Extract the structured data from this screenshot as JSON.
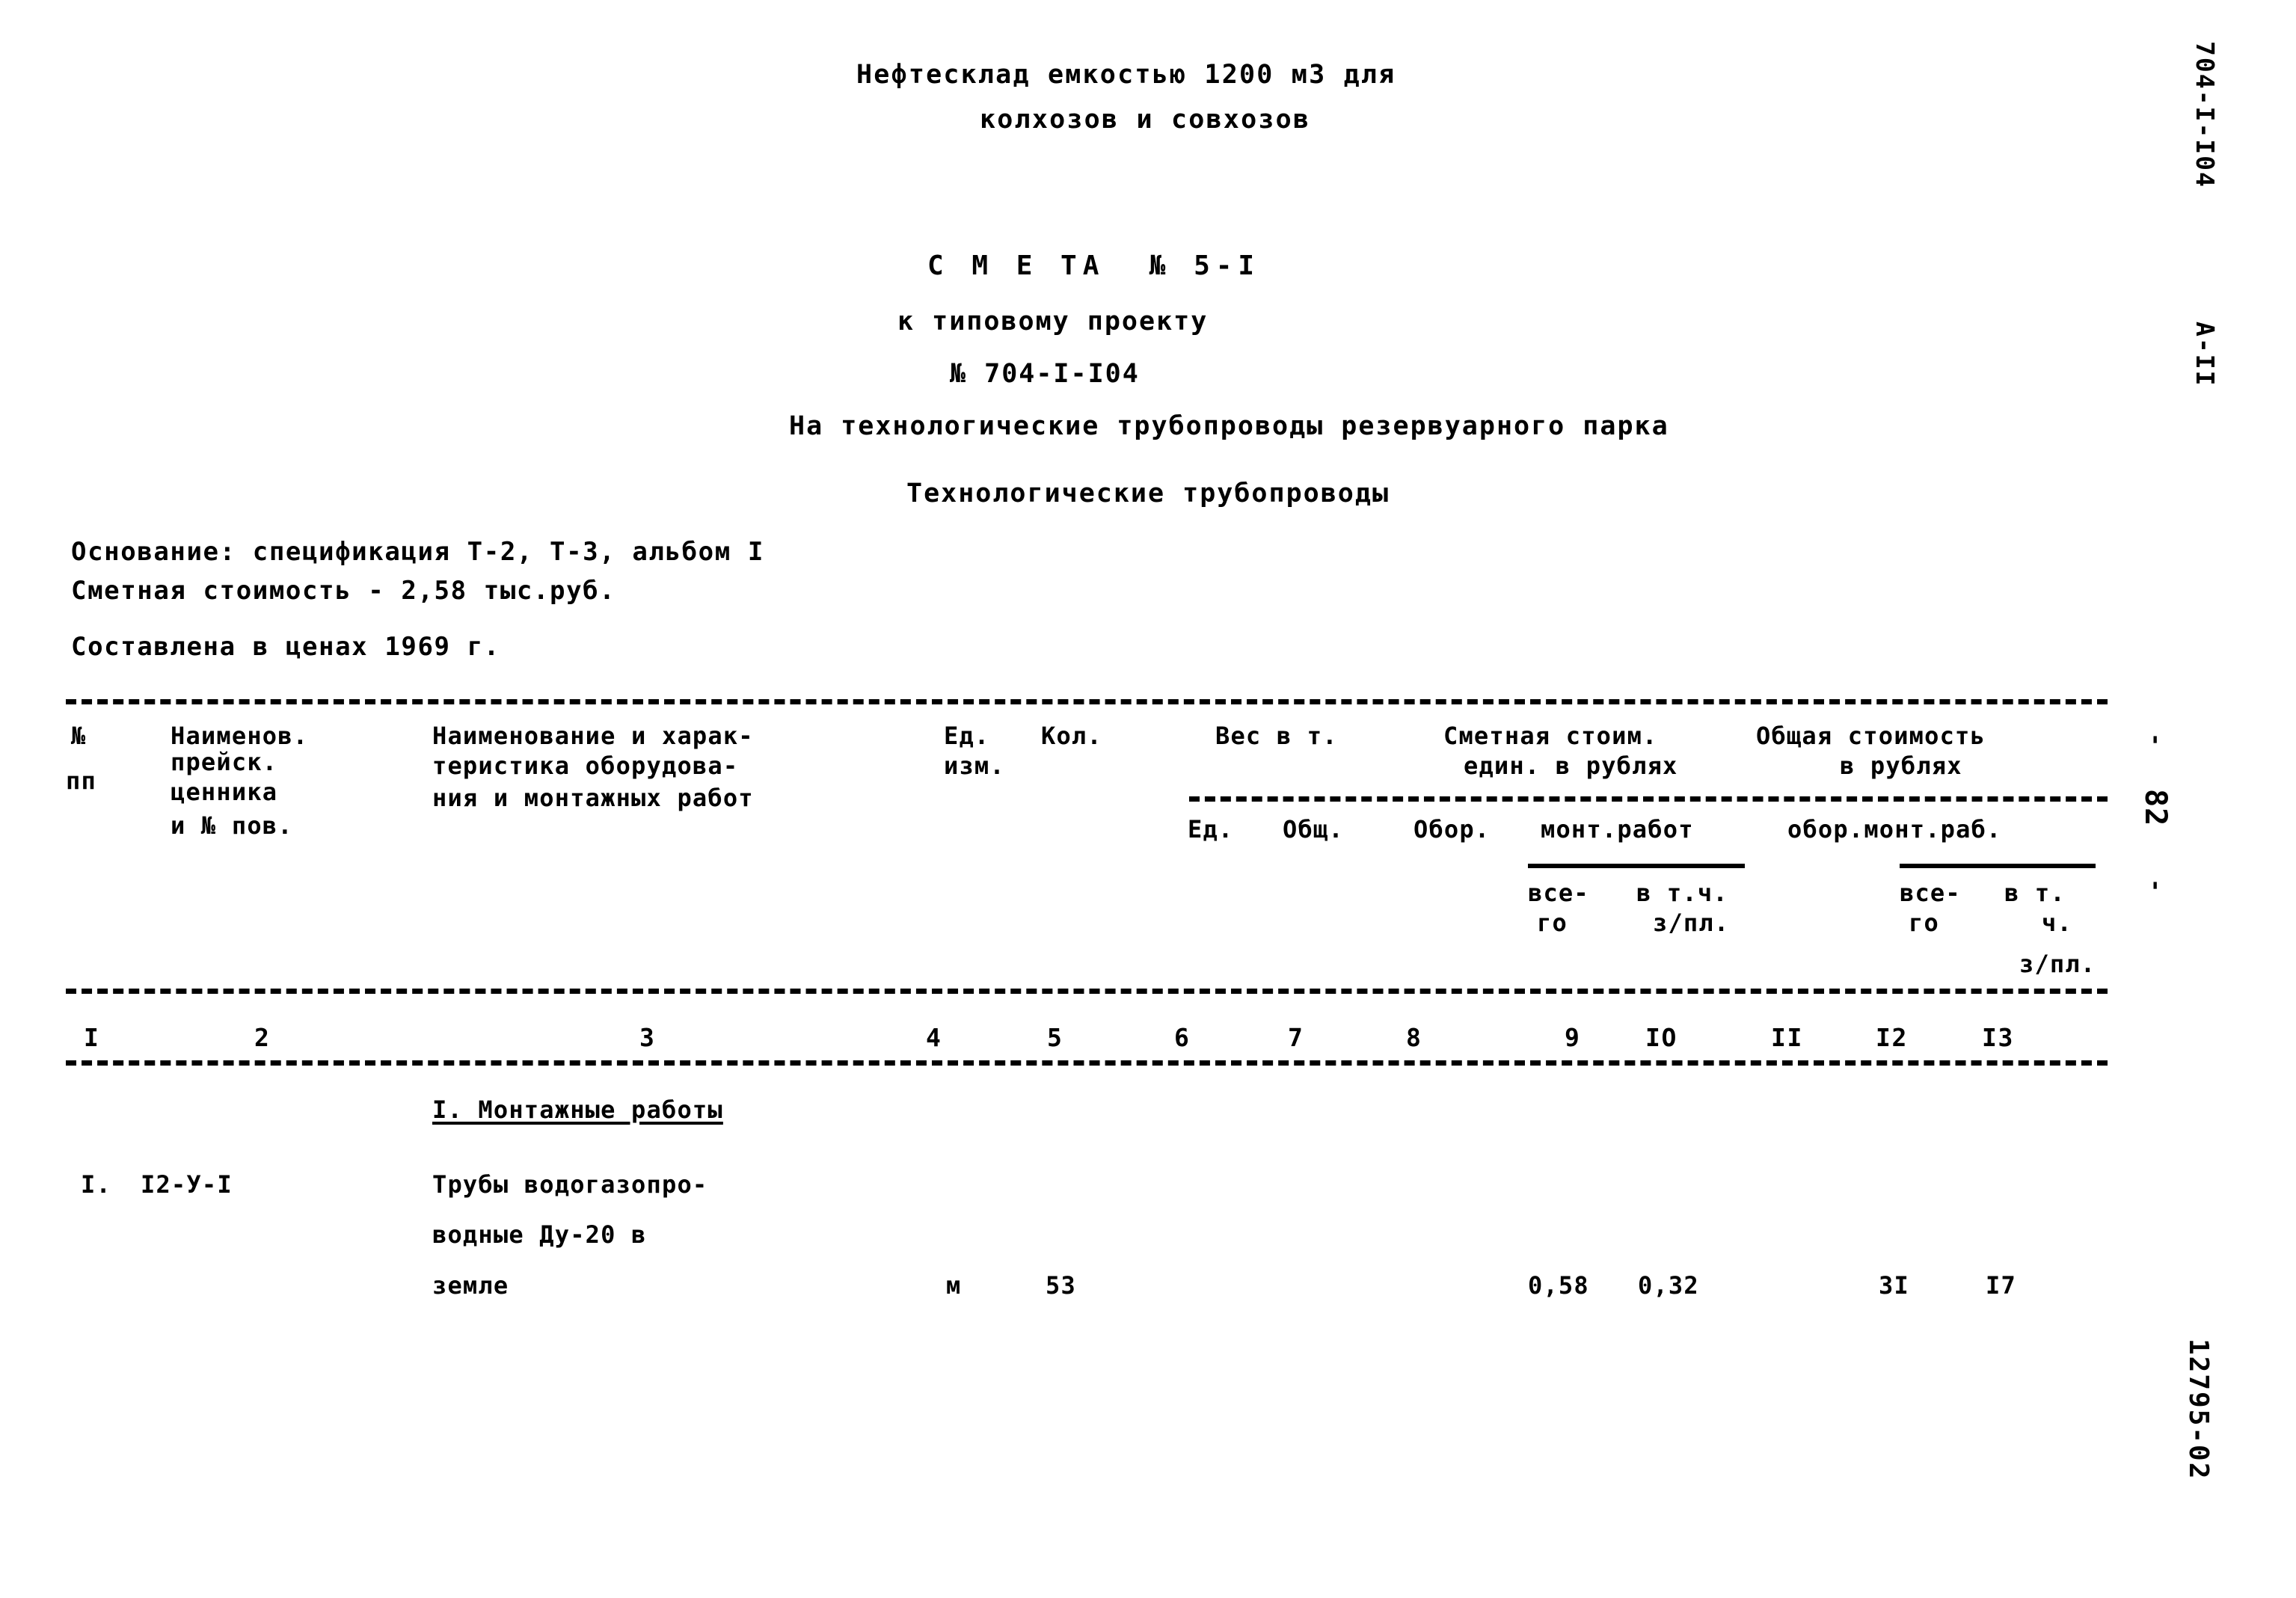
{
  "document": {
    "header_line1": "Нефтесклад емкостью 1200 м3 для",
    "header_line2": "колхозов и совхозов",
    "title": "С М Е ТА  № 5-I",
    "subtitle1": "к типовому проекту",
    "subtitle2": "№ 704-I-I04",
    "subtitle3": "На технологические трубопроводы резервуарного парка",
    "subtitle4": "Технологические трубопроводы",
    "basis": "Основание: спецификация Т-2, Т-3, альбом I",
    "estimate_cost": "Сметная стоимость - 2,58 тыс.руб.",
    "price_year": "Составлена в ценах 1969 г."
  },
  "table": {
    "headers": {
      "col1_l1": "№",
      "col1_l2": "пп",
      "col2_l1": "Наименов.",
      "col2_l2": "прейск.",
      "col2_l3": "ценника",
      "col2_l4": "и № пов.",
      "col3_l1": "Наименование и харак-",
      "col3_l2": "теристика оборудова-",
      "col3_l3": "ния и монтажных работ",
      "col4_l1": "Ед.",
      "col4_l2": "изм.",
      "col5_l1": "Кол.",
      "col6_group": "Вес в т.",
      "col7_group_l1": "Сметная стоим.",
      "col7_group_l2": "един. в рублях",
      "col8_group_l1": "Общая стоимость",
      "col8_group_l2": "в рублях",
      "sub_ed": "Ед.",
      "sub_obsh": "Общ.",
      "sub_obor": "Обор.",
      "sub_mont_rabot": "монт.работ",
      "sub_obor_mont_rab": "обор.монт.раб.",
      "sub2_vsego_a_l1": "все-",
      "sub2_vsego_a_l2": "го",
      "sub2_vtch_a_l1": "в т.ч.",
      "sub2_vtch_a_l2": "з/пл.",
      "sub2_vsego_b_l1": "все-",
      "sub2_vsego_b_l2": "го",
      "sub2_vtch_b_l1": "в т.",
      "sub2_vtch_b_l2": "ч.",
      "sub2_vtch_b_l3": "з/пл."
    },
    "column_numbers": [
      "I",
      "2",
      "3",
      "4",
      "5",
      "6",
      "7",
      "8",
      "9",
      "IO",
      "II",
      "I2",
      "I3"
    ],
    "section_title": "I. Монтажные работы",
    "rows": [
      {
        "num": "I.",
        "price_code": "I2-У-I",
        "desc_l1": "Трубы водогазопро-",
        "desc_l2": "водные Ду-20 в",
        "desc_l3": "земле",
        "unit": "м",
        "qty": "53",
        "weight_unit": "",
        "weight_total": "",
        "cost_equip": "",
        "cost_mont": "0,58",
        "cost_mont_zp": "0,32",
        "total_equip": "",
        "total_mont": "3I",
        "total_mont_zp": "I7"
      }
    ]
  },
  "margins": {
    "project_code": "704-I-I04",
    "album": "А-II",
    "page_number": "82",
    "page_dash_left": "-",
    "page_dash_right": "-",
    "archive_stamp": "12795-02"
  }
}
